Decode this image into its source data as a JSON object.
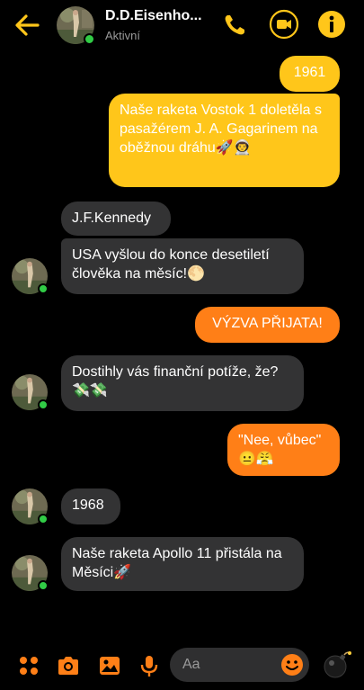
{
  "contact": {
    "name": "D.D.Eisenho...",
    "status": "Aktivní"
  },
  "messages": [
    {
      "side": "out",
      "color": "yellow",
      "text": "1961"
    },
    {
      "side": "out",
      "color": "yellow",
      "text": "Naše raketa Vostok 1 doletěla s pasažérem J. A. Gagarinem na oběžnou dráhu🚀👨‍🚀"
    },
    {
      "side": "in",
      "text": "J.F.Kennedy"
    },
    {
      "side": "in",
      "text": "USA vyšlou do konce desetiletí člověka na měsíc!🌕"
    },
    {
      "side": "out",
      "color": "orange",
      "text": "VÝZVA PŘIJATA!"
    },
    {
      "side": "in",
      "text": "Dostihly vás finanční potíže, že?💸💸"
    },
    {
      "side": "out",
      "color": "orange",
      "text": "\"Nee, vůbec\" 😐😤"
    },
    {
      "side": "in",
      "text": "1968"
    },
    {
      "side": "in",
      "text": "Naše raketa Apollo 11 přistála na Měsíci🚀"
    }
  ],
  "composer": {
    "placeholder": "Aa"
  },
  "colors": {
    "accent": "#ffc61a",
    "orange": "#ff7f17",
    "online": "#31cc46",
    "incoming": "#333334"
  }
}
